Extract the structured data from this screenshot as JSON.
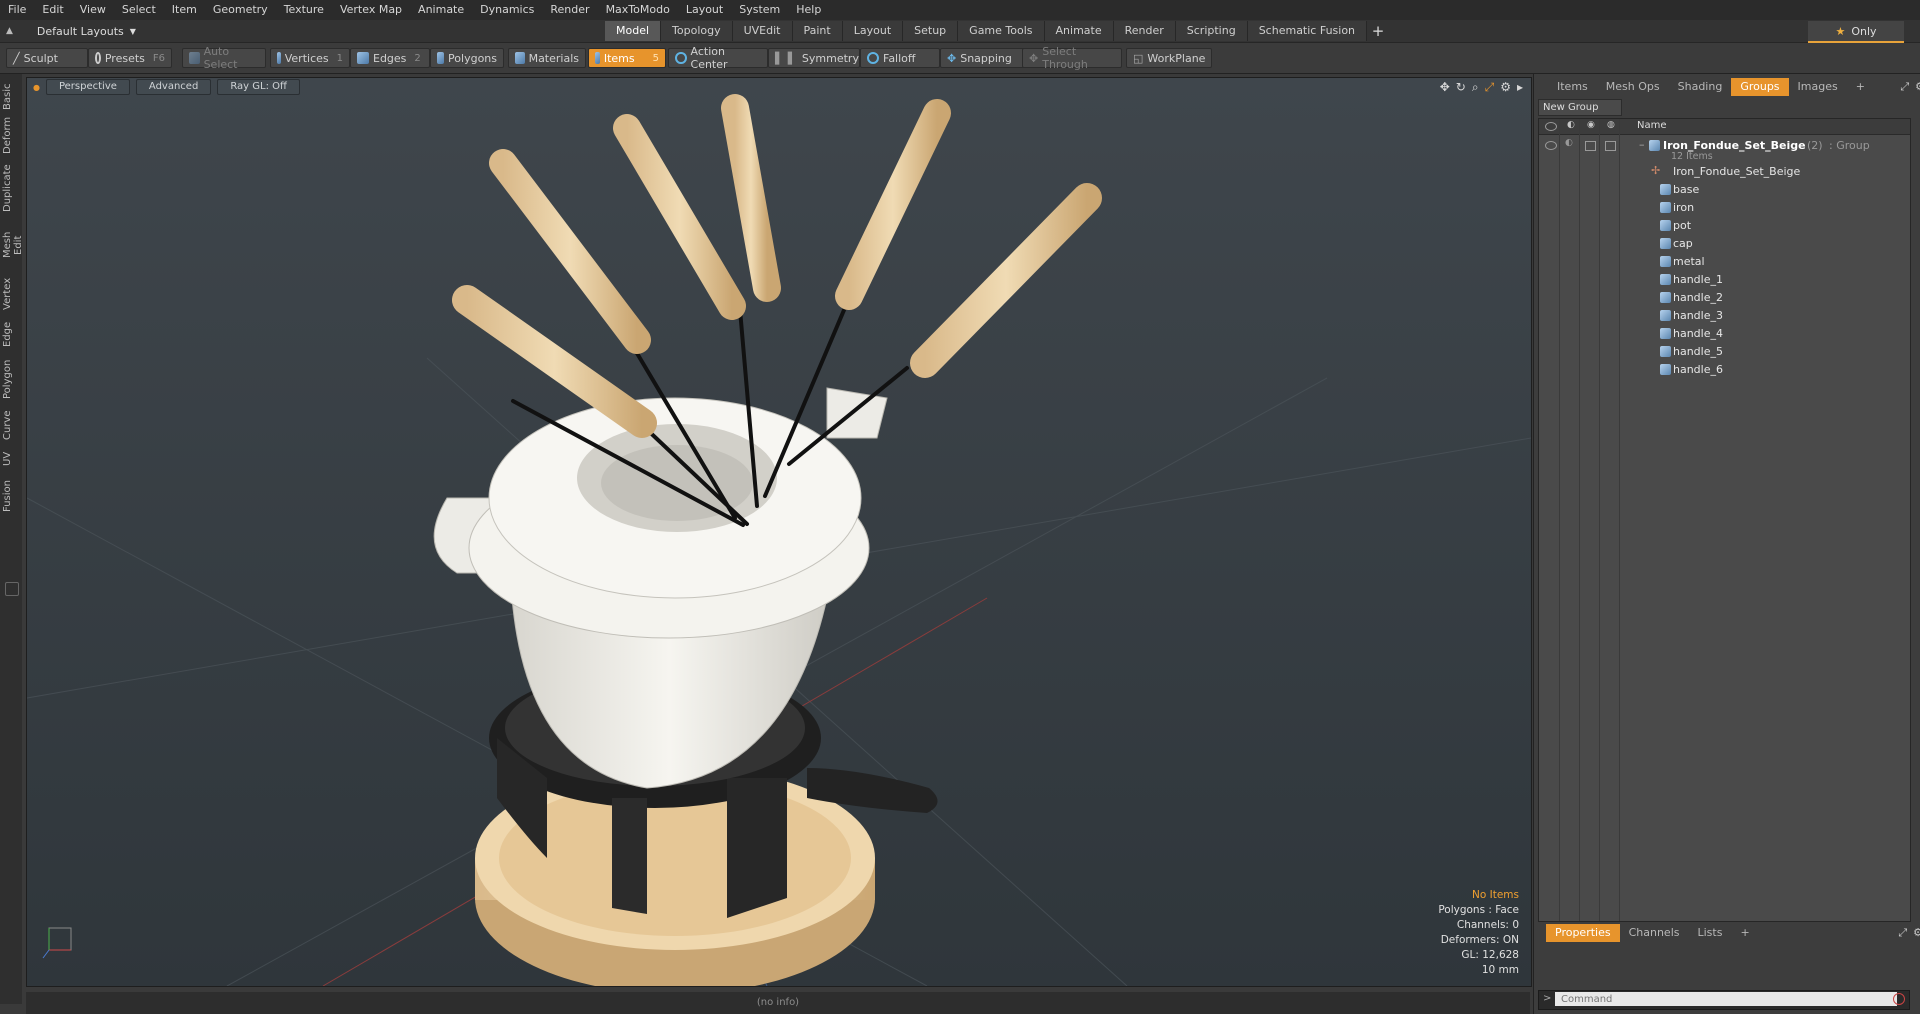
{
  "menu": [
    "File",
    "Edit",
    "View",
    "Select",
    "Item",
    "Geometry",
    "Texture",
    "Vertex Map",
    "Animate",
    "Dynamics",
    "Render",
    "MaxToModo",
    "Layout",
    "System",
    "Help"
  ],
  "layout": {
    "dropdown": "Default Layouts"
  },
  "tabs": [
    "Model",
    "Topology",
    "UVEdit",
    "Paint",
    "Layout",
    "Setup",
    "Game Tools",
    "Animate",
    "Render",
    "Scripting",
    "Schematic Fusion"
  ],
  "only_label": "Only",
  "toolbar": {
    "sculpt": "Sculpt",
    "presets": "Presets",
    "presets_key": "F6",
    "auto_select": "Auto Select",
    "vertices": "Vertices",
    "vertices_key": "1",
    "edges": "Edges",
    "edges_key": "2",
    "polygons": "Polygons",
    "materials": "Materials",
    "items": "Items",
    "items_key": "5",
    "action_center": "Action Center",
    "symmetry": "Symmetry",
    "falloff": "Falloff",
    "snapping": "Snapping",
    "select_through": "Select Through",
    "workplane": "WorkPlane"
  },
  "left_tabs": [
    "Basic",
    "Deform",
    "Duplicate",
    "Mesh Edit",
    "Vertex",
    "Edge",
    "Polygon",
    "Curve",
    "UV",
    "Fusion"
  ],
  "viewport": {
    "view": "Perspective",
    "shading": "Advanced",
    "raygl": "Ray GL: Off",
    "info": {
      "selection": "No Items",
      "polygons": "Polygons : Face",
      "channels": "Channels: 0",
      "deformers": "Deformers: ON",
      "gl": "GL: 12,628",
      "scale": "10 mm"
    }
  },
  "status": "(no info)",
  "right_panel": {
    "tabs": [
      "Items",
      "Mesh Ops",
      "Shading",
      "Groups",
      "Images"
    ],
    "new_group": "New Group",
    "name_header": "Name",
    "group": {
      "name": "Iron_Fondue_Set_Beige",
      "count": "(2)",
      "type": ": Group",
      "items": "12 Items"
    },
    "children": [
      "Iron_Fondue_Set_Beige",
      "base",
      "iron",
      "pot",
      "cap",
      "metal",
      "handle_1",
      "handle_2",
      "handle_3",
      "handle_4",
      "handle_5",
      "handle_6"
    ],
    "bottom_tabs": [
      "Properties",
      "Channels",
      "Lists"
    ],
    "command_placeholder": "Command"
  },
  "colors": {
    "accent": "#e7942c",
    "wood": "#e6c99c",
    "ceramic": "#f2f0ea",
    "iron": "#262626"
  }
}
